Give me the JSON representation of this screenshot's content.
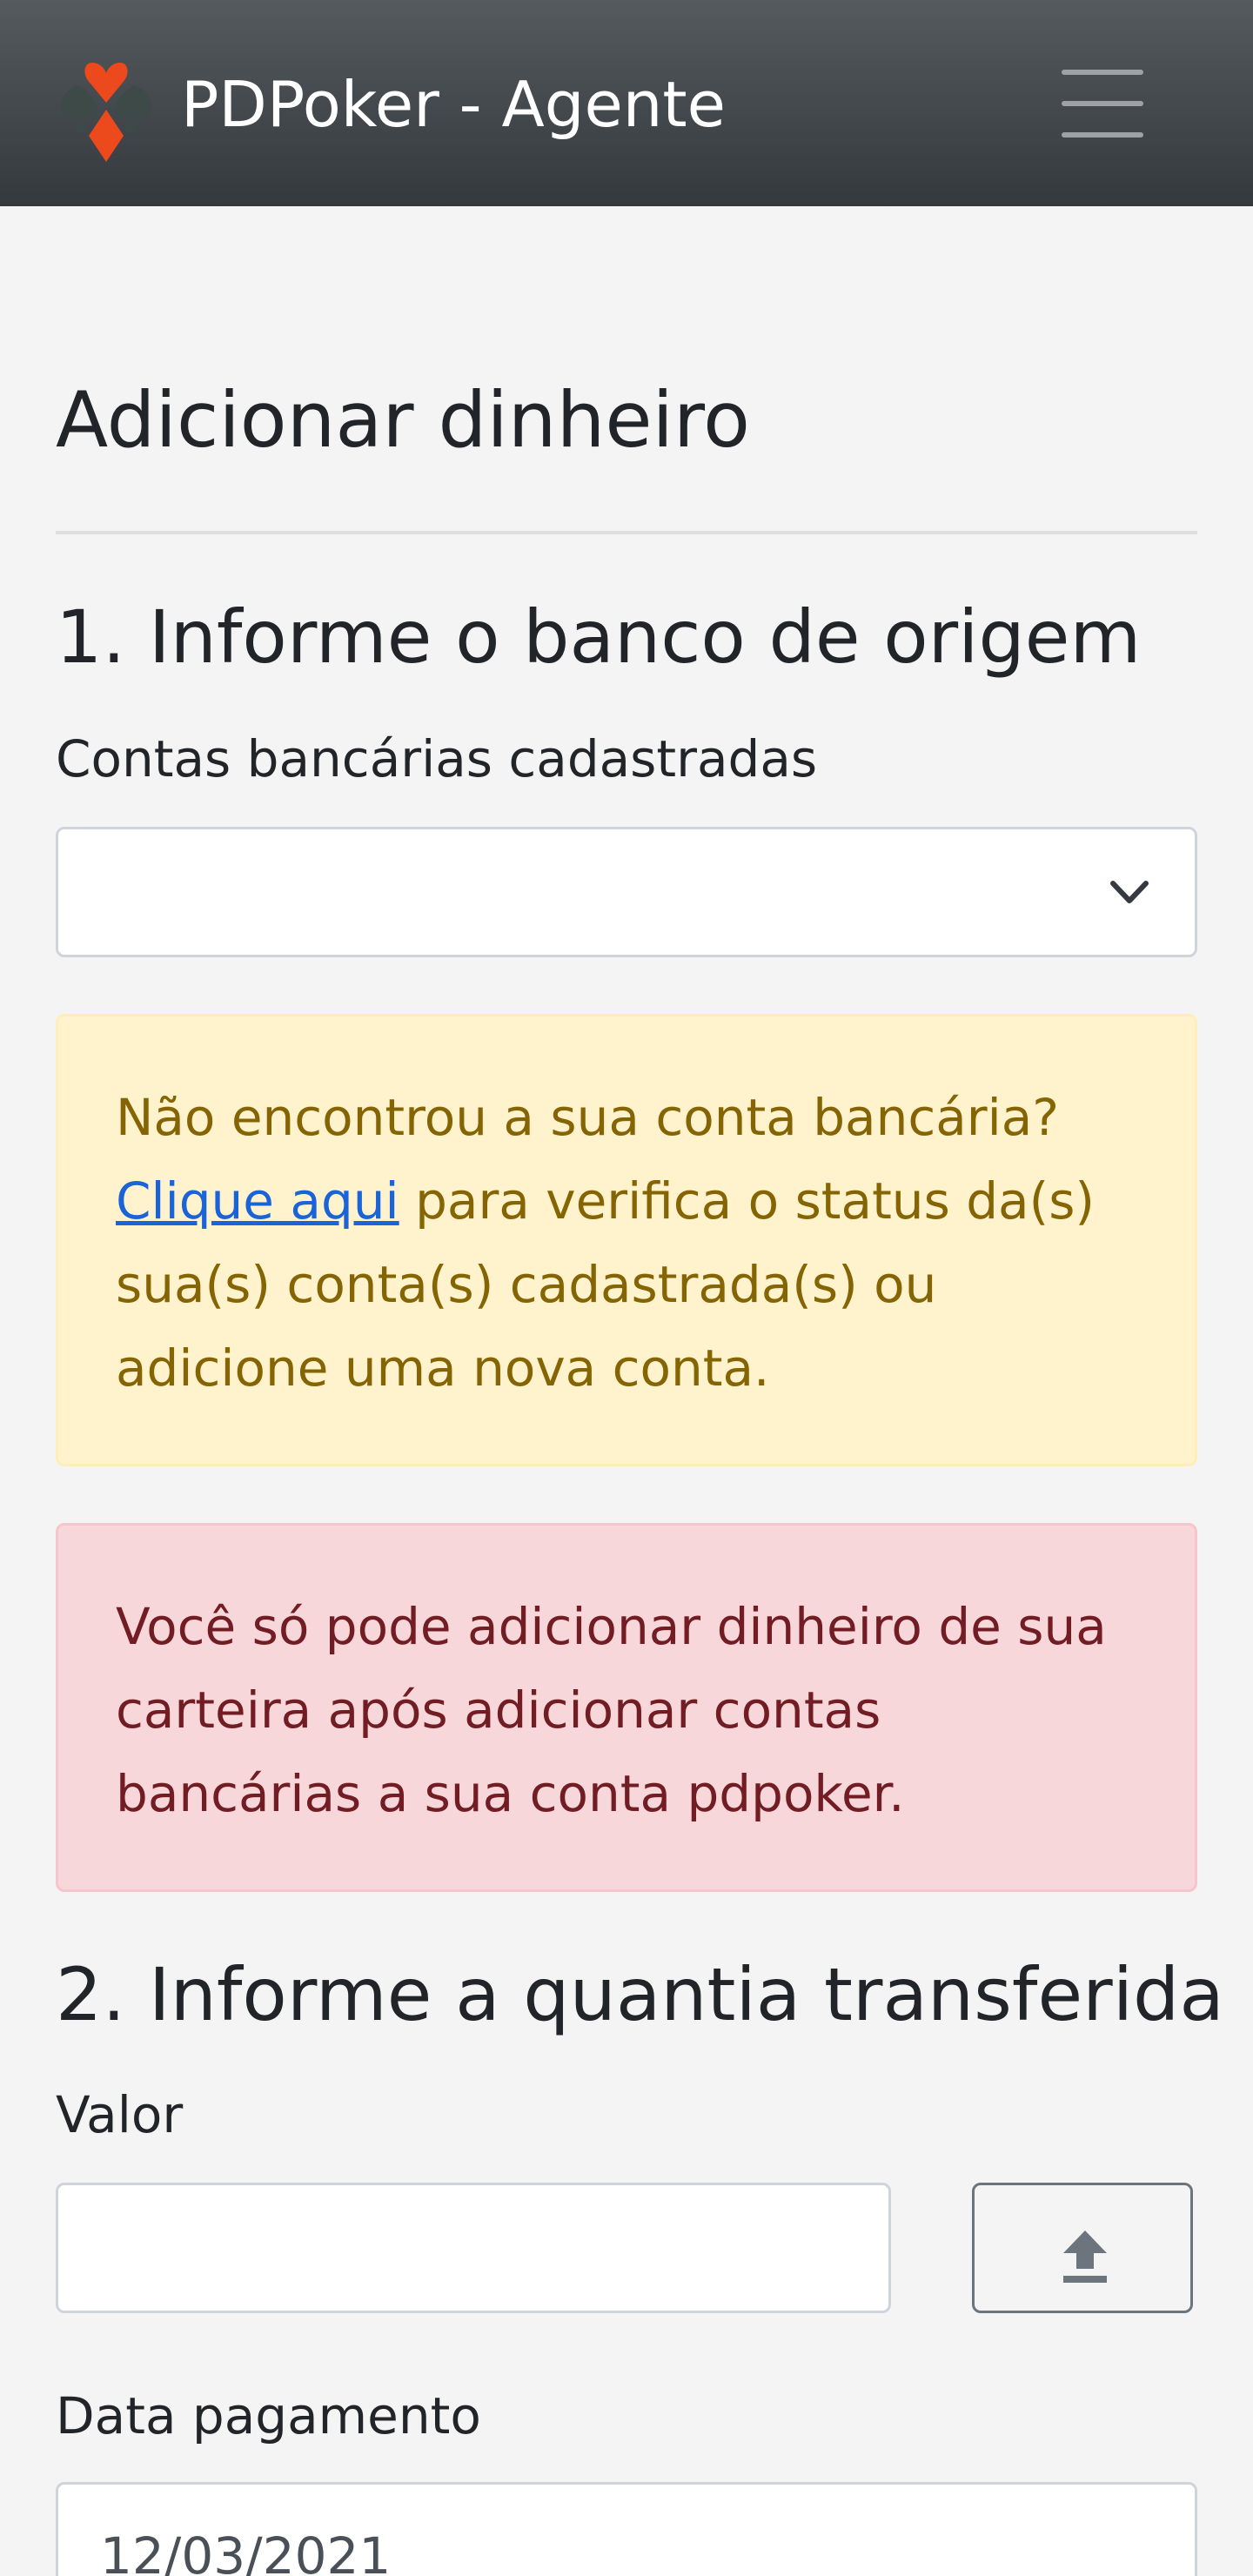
{
  "header": {
    "brand": "PDPoker - Agente",
    "logo_icon": "poker-suits-logo",
    "menu_icon": "hamburger-menu-icon"
  },
  "page": {
    "title": "Adicionar dinheiro"
  },
  "section1": {
    "title": "1. Informe o banco de origem",
    "accounts_label": "Contas bancárias cadastradas",
    "accounts_selected": ""
  },
  "warning_alert": {
    "intro": "Não encontrou a sua conta bancária?",
    "link_text": "Clique aqui",
    "rest": " para verifica o status da(s) sua(s) conta(s) cadastrada(s) ou adicione uma nova conta."
  },
  "danger_alert": {
    "text": "Você só pode adicionar dinheiro de sua carteira após adicionar contas bancárias a sua conta pdpoker."
  },
  "section2": {
    "title": "2. Informe a quantia transferida",
    "value_label": "Valor",
    "value": "",
    "upload_icon": "upload-icon",
    "date_label": "Data pagamento",
    "date_value": "12/03/2021"
  },
  "colors": {
    "navbar": "#34393e",
    "background": "#f4f4f4",
    "warning_bg": "#fff3cd",
    "warning_text": "#856404",
    "danger_bg": "#f8d7da",
    "danger_text": "#721c24",
    "link": "#1a64d8",
    "logo_red": "#ec4a1c",
    "logo_dark": "#3e4a48"
  }
}
